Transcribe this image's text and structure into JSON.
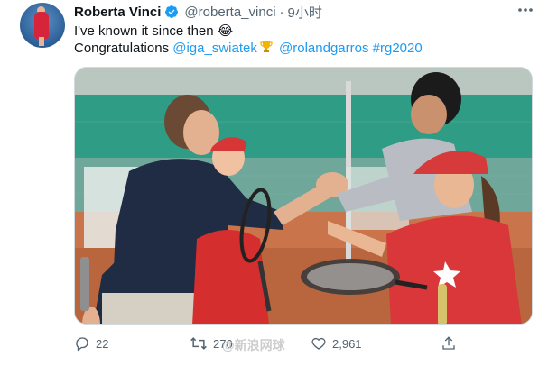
{
  "tweet": {
    "author_name": "Roberta Vinci",
    "handle": "@roberta_vinci",
    "separator": "·",
    "time": "9小时",
    "verified_icon": "verified-badge-icon",
    "more_icon": "more-options-icon",
    "line1": {
      "text": "I've known it since then ",
      "emoji": "😂"
    },
    "line2": {
      "prefix": "Congratulations ",
      "mention1": "@iga_swiatek",
      "trophy_icon": "trophy-icon",
      "mention2": "@rolandgarros",
      "hashtag": "#rg2020"
    },
    "photo_icon": "tennis-photo"
  },
  "actions": {
    "reply": {
      "icon": "reply-icon",
      "count": "22"
    },
    "retweet": {
      "icon": "retweet-icon",
      "count": "270"
    },
    "like": {
      "icon": "like-icon",
      "count": "2,961"
    },
    "share": {
      "icon": "share-icon"
    }
  },
  "watermark": {
    "text": "@新浪网球"
  },
  "colors": {
    "accent": "#1d9bf0",
    "text": "#0f1419",
    "muted": "#536471"
  }
}
